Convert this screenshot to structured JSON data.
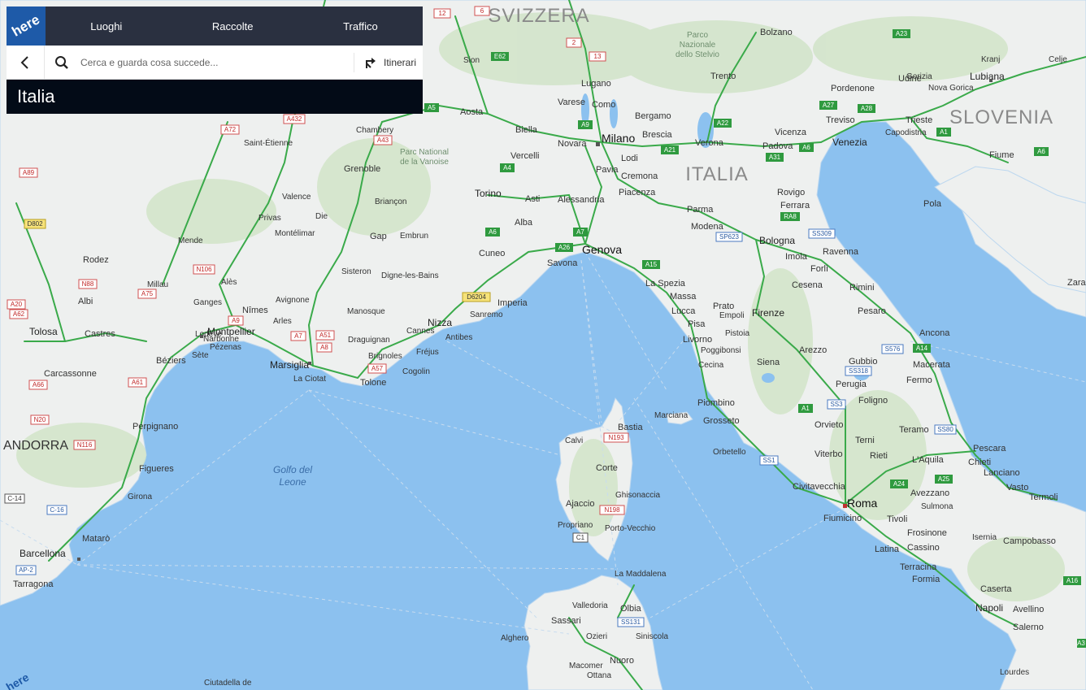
{
  "header": {
    "logo_text": "here",
    "nav": [
      "Luoghi",
      "Raccolte",
      "Traffico"
    ]
  },
  "search": {
    "placeholder": "Cerca e guarda cosa succede...",
    "routes_label": "Itinerari"
  },
  "region_title": "Italia",
  "icons": {
    "back": "chevron-left-icon",
    "search": "magnifier-icon",
    "routes": "route-arrow-icon"
  },
  "colors": {
    "sea": "#8cc1ef",
    "land": "#eef0ef",
    "roads": "#3aaa4a",
    "panel_top": "#2a3040",
    "panel_title": "#030b17",
    "logo": "#1e5aa8"
  },
  "map": {
    "countries": [
      {
        "name": "SVIZZERA",
        "cls": "country"
      },
      {
        "name": "ITALIA",
        "cls": "country"
      },
      {
        "name": "SLOVENIA",
        "cls": "country"
      },
      {
        "name": "ANDORRA",
        "cls": "country"
      }
    ],
    "seas": [
      {
        "name": "Golfo del"
      },
      {
        "name": "Leone"
      }
    ],
    "parks": [
      {
        "name": "Parc National"
      },
      {
        "name": "de la Vanoise"
      },
      {
        "name": "Parco"
      },
      {
        "name": "Nazionale"
      },
      {
        "name": "dello Stelvio"
      }
    ],
    "big_cities": [
      {
        "name": "Milano"
      },
      {
        "name": "Genova"
      },
      {
        "name": "Torino"
      },
      {
        "name": "Bologna"
      },
      {
        "name": "Firenze"
      },
      {
        "name": "Roma"
      },
      {
        "name": "Napoli"
      },
      {
        "name": "Venezia"
      },
      {
        "name": "Marsiglia"
      },
      {
        "name": "Montpellier"
      },
      {
        "name": "Barcellona"
      },
      {
        "name": "Lubiana"
      },
      {
        "name": "Nizza"
      },
      {
        "name": "Tolosa"
      }
    ],
    "cities": [
      {
        "name": "Bolzano"
      },
      {
        "name": "Trento"
      },
      {
        "name": "Bergamo"
      },
      {
        "name": "Brescia"
      },
      {
        "name": "Verona"
      },
      {
        "name": "Vicenza"
      },
      {
        "name": "Padova"
      },
      {
        "name": "Treviso"
      },
      {
        "name": "Trieste"
      },
      {
        "name": "Udine"
      },
      {
        "name": "Novara"
      },
      {
        "name": "Pavia"
      },
      {
        "name": "Lodi"
      },
      {
        "name": "Cremona"
      },
      {
        "name": "Piacenza"
      },
      {
        "name": "Parma"
      },
      {
        "name": "Modena"
      },
      {
        "name": "Ferrara"
      },
      {
        "name": "Rovigo"
      },
      {
        "name": "Ravenna"
      },
      {
        "name": "Forlì"
      },
      {
        "name": "Rimini"
      },
      {
        "name": "Pesaro"
      },
      {
        "name": "Ancona"
      },
      {
        "name": "Imola"
      },
      {
        "name": "Cesena"
      },
      {
        "name": "Prato"
      },
      {
        "name": "Pisa"
      },
      {
        "name": "Lucca"
      },
      {
        "name": "Livorno"
      },
      {
        "name": "Siena"
      },
      {
        "name": "Arezzo"
      },
      {
        "name": "Perugia"
      },
      {
        "name": "Foligno"
      },
      {
        "name": "Terni"
      },
      {
        "name": "Viterbo"
      },
      {
        "name": "Rieti"
      },
      {
        "name": "L'Aquila"
      },
      {
        "name": "Pescara"
      },
      {
        "name": "Chieti"
      },
      {
        "name": "Latina"
      },
      {
        "name": "Caserta"
      },
      {
        "name": "Salerno"
      },
      {
        "name": "Avellino"
      },
      {
        "name": "Fiumicino"
      },
      {
        "name": "Civitavecchia"
      },
      {
        "name": "Grosseto"
      },
      {
        "name": "Piombino"
      },
      {
        "name": "Massa"
      },
      {
        "name": "La Spezia"
      },
      {
        "name": "Savona"
      },
      {
        "name": "Cuneo"
      },
      {
        "name": "Asti"
      },
      {
        "name": "Alessandria"
      },
      {
        "name": "Alba"
      },
      {
        "name": "Vercelli"
      },
      {
        "name": "Biella"
      },
      {
        "name": "Aosta"
      },
      {
        "name": "Como"
      },
      {
        "name": "Varese"
      },
      {
        "name": "Lugano"
      },
      {
        "name": "Sion"
      },
      {
        "name": "Imperia"
      },
      {
        "name": "Sanremo"
      },
      {
        "name": "Bastia"
      },
      {
        "name": "Corte"
      },
      {
        "name": "Ajaccio"
      },
      {
        "name": "Calvi"
      },
      {
        "name": "Sassari"
      },
      {
        "name": "Olbia"
      },
      {
        "name": "Alghero"
      },
      {
        "name": "La Maddalena"
      },
      {
        "name": "Grenoble"
      },
      {
        "name": "Chambery"
      },
      {
        "name": "Saint-Étienne"
      },
      {
        "name": "Valence"
      },
      {
        "name": "Avignone"
      },
      {
        "name": "Nîmes"
      },
      {
        "name": "Arles"
      },
      {
        "name": "Tolone"
      },
      {
        "name": "Antibes"
      },
      {
        "name": "Cannes"
      },
      {
        "name": "Fréjus"
      },
      {
        "name": "Perpignano"
      },
      {
        "name": "Figueres"
      },
      {
        "name": "Girona"
      },
      {
        "name": "Tarragona"
      },
      {
        "name": "Matarò"
      },
      {
        "name": "Béziers"
      },
      {
        "name": "Sète"
      },
      {
        "name": "Carcassonne"
      },
      {
        "name": "Albi"
      },
      {
        "name": "Rodez"
      },
      {
        "name": "Castres"
      },
      {
        "name": "La Ciotat"
      },
      {
        "name": "Fiume"
      },
      {
        "name": "Capodistria"
      },
      {
        "name": "Pola"
      },
      {
        "name": "Zara"
      },
      {
        "name": "Kranj"
      },
      {
        "name": "Celje"
      },
      {
        "name": "Gorizia"
      },
      {
        "name": "Nova Gorica"
      },
      {
        "name": "Pordenone"
      },
      {
        "name": "Macerata"
      },
      {
        "name": "Fermo"
      },
      {
        "name": "Teramo"
      },
      {
        "name": "Gubbio"
      },
      {
        "name": "Orvieto"
      },
      {
        "name": "Frosinone"
      },
      {
        "name": "Cassino"
      },
      {
        "name": "Formia"
      },
      {
        "name": "Terracina"
      },
      {
        "name": "Isernia"
      },
      {
        "name": "Campobasso"
      },
      {
        "name": "Vasto"
      },
      {
        "name": "Termoli"
      },
      {
        "name": "Lanciano"
      },
      {
        "name": "Sulmona"
      },
      {
        "name": "Avezzano"
      },
      {
        "name": "Tivoli"
      },
      {
        "name": "Pistoia"
      },
      {
        "name": "Empoli"
      },
      {
        "name": "Poggibonsi"
      },
      {
        "name": "Cecina"
      },
      {
        "name": "Orbetello"
      },
      {
        "name": "Marciana"
      },
      {
        "name": "Porto-Vecchio"
      },
      {
        "name": "Propriano"
      },
      {
        "name": "Ghisonaccia"
      },
      {
        "name": "Valledoria"
      },
      {
        "name": "Ozieri"
      },
      {
        "name": "Siniscola"
      },
      {
        "name": "Nuoro"
      },
      {
        "name": "Macomer"
      },
      {
        "name": "Ottana"
      },
      {
        "name": "Ciutadella de"
      },
      {
        "name": "Digne-les-Bains"
      },
      {
        "name": "Manosque"
      },
      {
        "name": "Draguignan"
      },
      {
        "name": "Brignoles"
      },
      {
        "name": "Cogolin"
      },
      {
        "name": "Sisteron"
      },
      {
        "name": "Gap"
      },
      {
        "name": "Briançon"
      },
      {
        "name": "Embrun"
      },
      {
        "name": "Die"
      },
      {
        "name": "Privas"
      },
      {
        "name": "Montélimar"
      },
      {
        "name": "Alès"
      },
      {
        "name": "Mende"
      },
      {
        "name": "Millau"
      },
      {
        "name": "Ganges"
      },
      {
        "name": "Lodève"
      },
      {
        "name": "Pézenas"
      },
      {
        "name": "Narbonne"
      },
      {
        "name": "Lourdes"
      }
    ]
  }
}
